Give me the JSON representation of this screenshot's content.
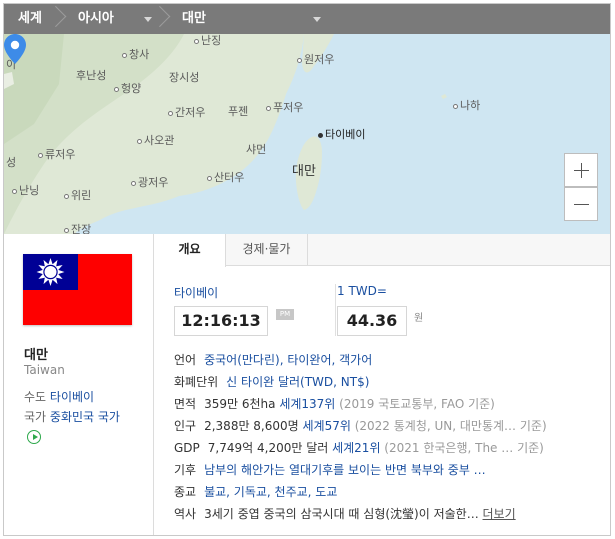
{
  "breadcrumb": {
    "world": "세계",
    "region": "아시아",
    "country": "대만"
  },
  "map": {
    "highlight_label": "대만",
    "cities": [
      {
        "name": "난징",
        "capital": false
      },
      {
        "name": "원저우",
        "capital": false
      },
      {
        "name": "창사",
        "capital": false
      },
      {
        "name": "후난성",
        "capital": false
      },
      {
        "name": "장시성",
        "capital": false
      },
      {
        "name": "헝양",
        "capital": false
      },
      {
        "name": "푸저우",
        "capital": false
      },
      {
        "name": "간저우",
        "capital": false
      },
      {
        "name": "푸젠",
        "capital": false
      },
      {
        "name": "타이베이",
        "capital": true
      },
      {
        "name": "나하",
        "capital": false
      },
      {
        "name": "사오관",
        "capital": false
      },
      {
        "name": "샤먼",
        "capital": false
      },
      {
        "name": "류저우",
        "capital": false
      },
      {
        "name": "광저우",
        "capital": false
      },
      {
        "name": "산터우",
        "capital": false
      },
      {
        "name": "난닝",
        "capital": false
      },
      {
        "name": "위린",
        "capital": false
      },
      {
        "name": "잔장",
        "capital": false
      },
      {
        "name": "성",
        "capital": false
      },
      {
        "name": "이",
        "capital": false
      }
    ],
    "controls": {
      "zoom_in": "zoom-in",
      "zoom_out": "zoom-out"
    }
  },
  "country": {
    "name": "대만",
    "name_en": "Taiwan",
    "capital_key": "수도",
    "capital": "타이베이",
    "anthem_key": "국가",
    "anthem": "중화민국 국가",
    "flag_colors": {
      "red": "#fe0000",
      "blue": "#000095",
      "white": "#ffffff"
    }
  },
  "tabs": [
    {
      "label": "개요",
      "active": true
    },
    {
      "label": "경제·물가",
      "active": false
    }
  ],
  "time": {
    "city": "타이베이",
    "clock": "12:16:13",
    "ampm": "PM"
  },
  "exchange": {
    "label": "1 TWD=",
    "rate": "44.36",
    "unit": "원"
  },
  "facts": [
    {
      "key": "언어",
      "parts": [
        {
          "s": "b",
          "text": "중국어(만다린), 타이완어, 객가어"
        }
      ]
    },
    {
      "key": "화폐단위",
      "parts": [
        {
          "s": "b",
          "text": "신 타이완 달러(TWD, NT$)"
        }
      ]
    },
    {
      "key": "면적",
      "parts": [
        {
          "s": "t",
          "text": "359만 6천ha "
        },
        {
          "s": "b",
          "text": "세계137위"
        },
        {
          "s": "g",
          "text": " (2019 국토교통부, FAO 기준)"
        }
      ]
    },
    {
      "key": "인구",
      "parts": [
        {
          "s": "t",
          "text": "2,388만 8,600명 "
        },
        {
          "s": "b",
          "text": "세계57위"
        },
        {
          "s": "g",
          "text": " (2022 통계청, UN, 대만통계… 기준)"
        }
      ]
    },
    {
      "key": "GDP",
      "parts": [
        {
          "s": "t",
          "text": "7,749억 4,200만 달러 "
        },
        {
          "s": "b",
          "text": "세계21위"
        },
        {
          "s": "g",
          "text": " (2021 한국은행, The … 기준)"
        }
      ]
    },
    {
      "key": "기후",
      "parts": [
        {
          "s": "b",
          "text": "남부의 해안가는 열대기후를 보이는 반면 북부와 중부 …"
        }
      ]
    },
    {
      "key": "종교",
      "parts": [
        {
          "s": "b",
          "text": "불교, 기독교, 천주교, 도교"
        }
      ]
    },
    {
      "key": "역사",
      "parts": [
        {
          "s": "t",
          "text": "3세기 중엽 중국의 삼국시대 때 심형(沈瑩)이 저술한… "
        }
      ],
      "more": "더보기"
    }
  ]
}
